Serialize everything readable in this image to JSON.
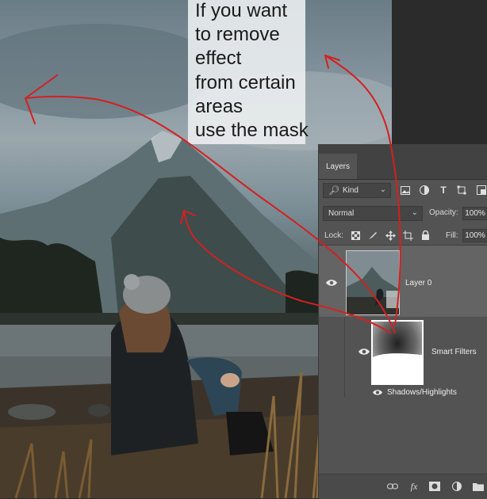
{
  "annotation": {
    "lines": [
      "If you want",
      "to remove",
      "effect",
      "from certain",
      " areas",
      "use the mask"
    ]
  },
  "layers_panel": {
    "tab_label": "Layers",
    "filter_kind": "Kind",
    "blend_mode": "Normal",
    "opacity_label": "Opacity:",
    "opacity_value": "100%",
    "lock_label": "Lock:",
    "fill_label": "Fill:",
    "fill_value": "100%",
    "layers": [
      {
        "name": "Layer 0",
        "visible": true
      },
      {
        "name": "Smart Filters",
        "visible": true
      },
      {
        "name": "Shadows/Highlights",
        "visible": true
      }
    ]
  },
  "icons": {
    "filter": [
      "image-filter-icon",
      "adjustment-filter-icon",
      "type-filter-icon",
      "shape-filter-icon",
      "smart-object-filter-icon"
    ],
    "lock": [
      "lock-pixels-icon",
      "lock-image-icon",
      "lock-position-icon",
      "lock-artboard-icon",
      "lock-all-icon"
    ],
    "bottom": [
      "link-layers-icon",
      "fx-icon",
      "add-mask-icon",
      "adjustment-layer-icon",
      "new-group-icon"
    ]
  },
  "colors": {
    "annotation_arrow": "#d42020",
    "panel_bg": "#535353",
    "selected_layer": "#646464"
  }
}
